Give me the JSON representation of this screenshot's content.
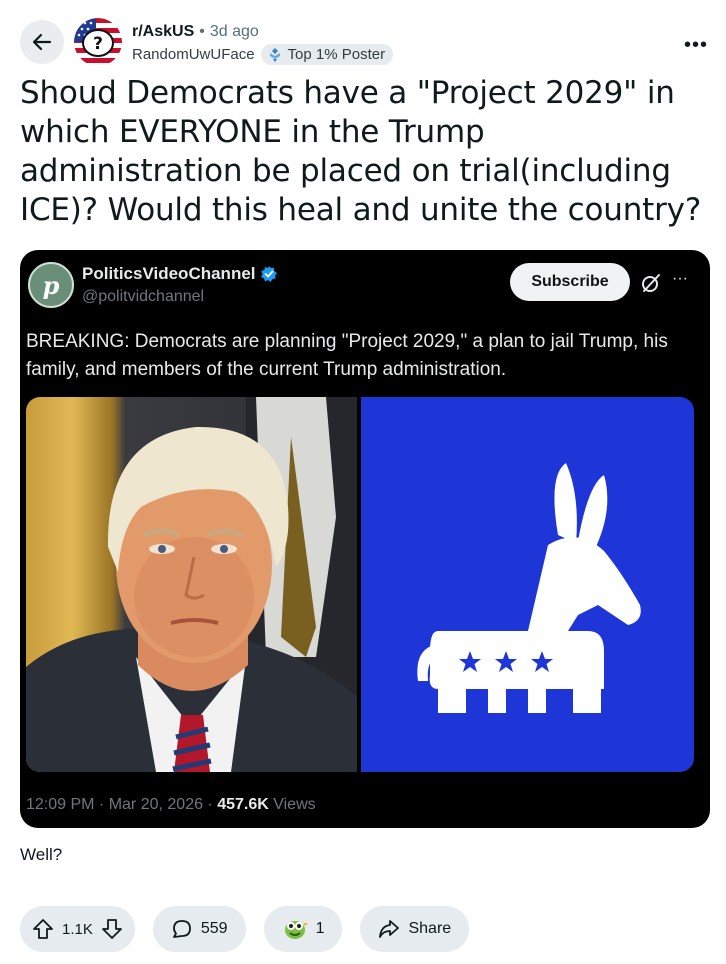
{
  "header": {
    "subreddit": "r/AskUS",
    "separator": "•",
    "time_ago": "3d ago",
    "username": "RandomUwUFace",
    "flair": "Top 1% Poster",
    "more_label": "•••"
  },
  "post": {
    "title": "Shoud Democrats have a \"Project 2029\" in which EVERYONE in the Trump administration be placed on trial(including ICE)? Would this heal and unite the country?",
    "body": "Well?"
  },
  "tweet": {
    "avatar_letter": "p",
    "display_name": "PoliticsVideoChannel",
    "handle": "@politvidchannel",
    "subscribe_label": "Subscribe",
    "more_label": "···",
    "text": "BREAKING: Democrats are planning \"Project 2029,\" a plan to jail Trump, his family, and members of the current Trump administration.",
    "timestamp": "12:09 PM · Mar 20, 2026 · ",
    "views_count": "457.6K",
    "views_label": " Views"
  },
  "actions": {
    "score": "1.1K",
    "comments": "559",
    "awards": "1",
    "share_label": "Share"
  },
  "colors": {
    "pill_bg": "#e5ebee",
    "tweet_bg": "#000000",
    "democrat_blue": "#1e36d8",
    "verified_blue": "#1d9bf0"
  },
  "icons": [
    "back-arrow-icon",
    "subreddit-avatar-icon",
    "flair-icon",
    "verified-badge-icon",
    "grok-icon",
    "upvote-icon",
    "downvote-icon",
    "comment-icon",
    "award-icon",
    "share-icon"
  ]
}
